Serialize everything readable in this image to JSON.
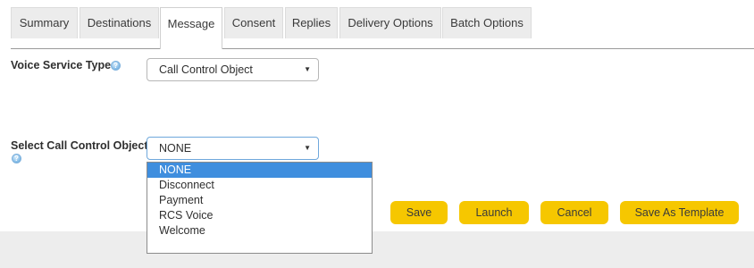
{
  "tabs": [
    {
      "label": "Summary"
    },
    {
      "label": "Destinations"
    },
    {
      "label": "Message"
    },
    {
      "label": "Consent"
    },
    {
      "label": "Replies"
    },
    {
      "label": "Delivery Options"
    },
    {
      "label": "Batch Options"
    }
  ],
  "active_tab": "Message",
  "voice_service_type": {
    "label": "Voice Service Type",
    "value": "Call Control Object"
  },
  "call_control_object": {
    "label": "Select Call Control Object",
    "value": "NONE",
    "options": [
      "NONE",
      "Disconnect",
      "Payment",
      "RCS Voice",
      "Welcome"
    ]
  },
  "icons": {
    "help": "help-icon",
    "caret": "chevron-down-icon",
    "caret_glyph": "▼",
    "help_glyph": "?"
  },
  "buttons": {
    "save": "Save",
    "launch": "Launch",
    "cancel": "Cancel",
    "save_as_template": "Save As Template"
  },
  "colors": {
    "accent_button": "#f6c700",
    "selected_option": "#3f8ede",
    "tab_background": "#ececec"
  }
}
